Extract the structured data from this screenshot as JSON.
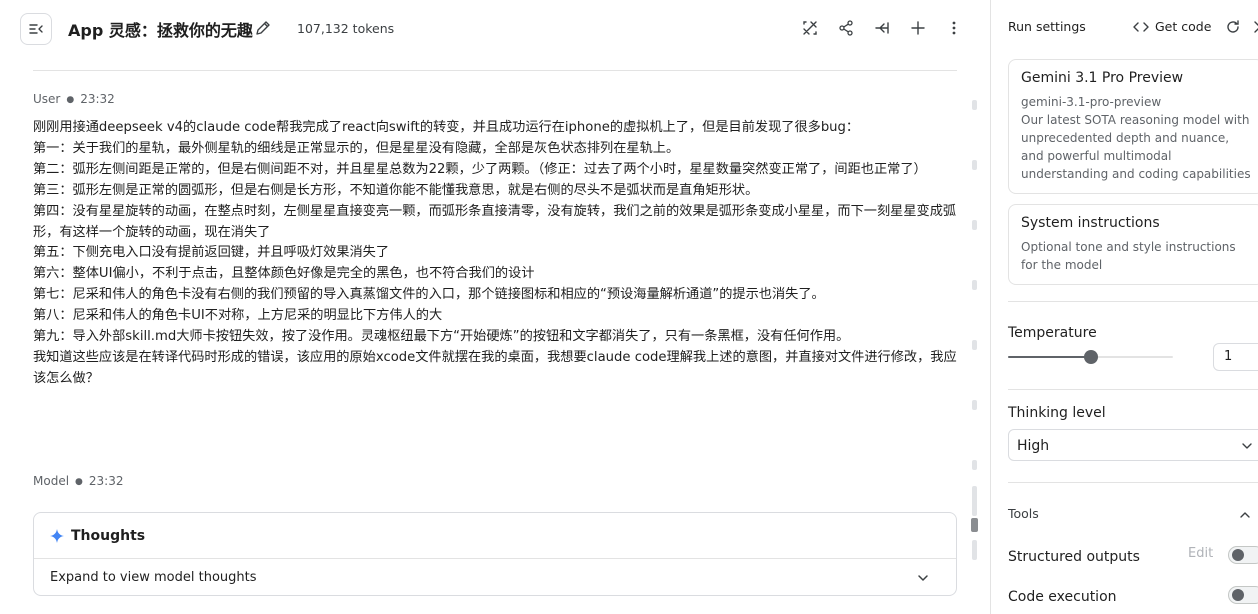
{
  "header": {
    "title": "App 灵感：拯救你的无趣",
    "tokens": "107,132 tokens"
  },
  "user_message": {
    "role": "User",
    "time": "23:32",
    "lines": [
      "刚刚用接通deepseek v4的claude code帮我完成了react向swift的转变，并且成功运行在iphone的虚拟机上了，但是目前发现了很多bug：",
      "第一：关于我们的星轨，最外侧星轨的细线是正常显示的，但是星星没有隐藏，全部是灰色状态排列在星轨上。",
      "第二：弧形左侧间距是正常的，但是右侧间距不对，并且星星总数为22颗，少了两颗。（修正：过去了两个小时，星星数量突然变正常了，间距也正常了）",
      "第三：弧形左侧是正常的圆弧形，但是右侧是长方形，不知道你能不能懂我意思，就是右侧的尽头不是弧状而是直角矩形状。",
      "第四：没有星星旋转的动画，在整点时刻，左侧星星直接变亮一颗，而弧形条直接清零，没有旋转，我们之前的效果是弧形条变成小星星，而下一刻星星变成弧形，有这样一个旋转的动画，现在消失了",
      "第五：下侧充电入口没有提前返回键，并且呼吸灯效果消失了",
      "第六：整体UI偏小，不利于点击，且整体颜色好像是完全的黑色，也不符合我们的设计",
      "第七：尼采和伟人的角色卡没有右侧的我们预留的导入真蒸馏文件的入口，那个链接图标和相应的“预设海量解析通道”的提示也消失了。",
      "第八：尼采和伟人的角色卡UI不对称，上方尼采的明显比下方伟人的大",
      "第九：导入外部skill.md大师卡按钮失效，按了没作用。灵魂枢纽最下方“开始硬炼”的按钮和文字都消失了，只有一条黑框，没有任何作用。",
      "我知道这些应该是在转译代码时形成的错误，该应用的原始xcode文件就摆在我的桌面，我想要claude code理解我上述的意图，并直接对文件进行修改，我应该怎么做？"
    ]
  },
  "model_message": {
    "role": "Model",
    "time": "23:32",
    "thoughts_title": "Thoughts",
    "thoughts_expand": "Expand to view model thoughts"
  },
  "panel": {
    "title": "Run settings",
    "get_code": "Get code",
    "model": {
      "name": "Gemini 3.1 Pro Preview",
      "id": "gemini-3.1-pro-preview",
      "description": "Our latest SOTA reasoning model with unprecedented depth and nuance, and powerful multimodal understanding and coding capabilities"
    },
    "system_instructions": {
      "title": "System instructions",
      "placeholder": "Optional tone and style instructions for the model"
    },
    "temperature": {
      "label": "Temperature",
      "value": "1",
      "fraction": 0.5
    },
    "thinking_level": {
      "label": "Thinking level",
      "value": "High"
    },
    "tools": {
      "label": "Tools",
      "structured_outputs": "Structured outputs",
      "edit": "Edit",
      "code_execution": "Code execution"
    }
  }
}
